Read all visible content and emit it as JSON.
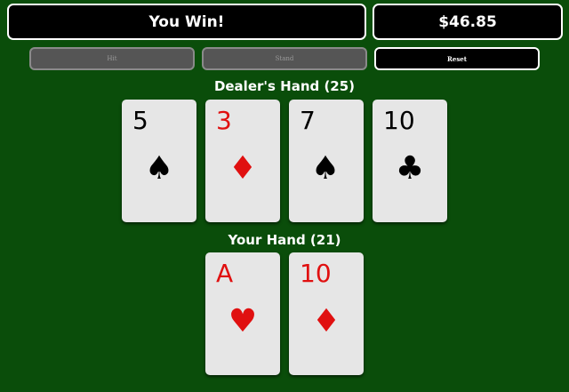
{
  "status": {
    "message": "You Win!",
    "balance": "$46.85"
  },
  "controls": {
    "hit_label": "Hit",
    "stand_label": "Stand",
    "reset_label": "Reset"
  },
  "dealer": {
    "label": "Dealer's Hand (25)",
    "cards": [
      {
        "rank": "5",
        "suit": "♠",
        "suit_name": "spade",
        "color": "#000000"
      },
      {
        "rank": "3",
        "suit": "♦",
        "suit_name": "diamond",
        "color": "#e01010"
      },
      {
        "rank": "7",
        "suit": "♠",
        "suit_name": "spade",
        "color": "#000000"
      },
      {
        "rank": "10",
        "suit": "♣",
        "suit_name": "club",
        "color": "#000000"
      }
    ]
  },
  "player": {
    "label": "Your Hand (21)",
    "cards": [
      {
        "rank": "A",
        "suit": "♥",
        "suit_name": "heart",
        "color": "#e01010"
      },
      {
        "rank": "10",
        "suit": "♦",
        "suit_name": "diamond",
        "color": "#e01010"
      }
    ]
  }
}
